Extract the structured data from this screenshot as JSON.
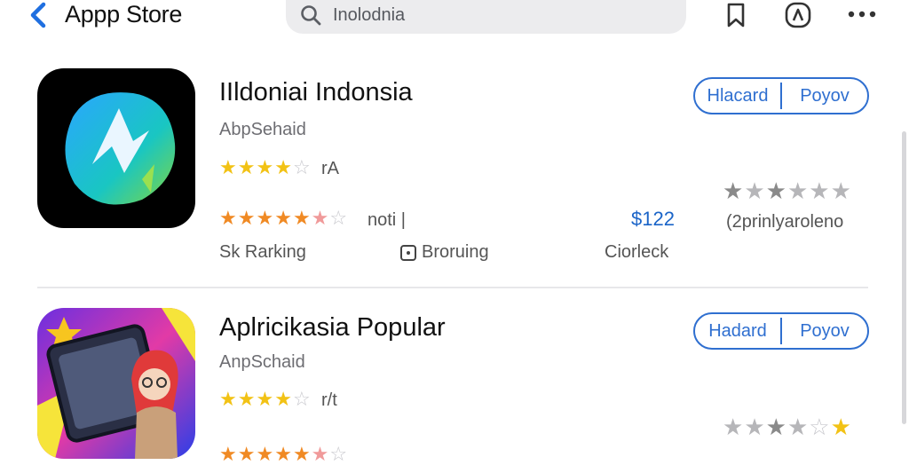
{
  "header": {
    "title": "Appp Store",
    "search_text": "Inolodnia"
  },
  "apps": [
    {
      "name": "IIldoniai Indonsia",
      "developer": "AbpSehaid",
      "rating_label": "rA",
      "rating2_label": "noti |",
      "price": "$122",
      "button_left": "Hlacard",
      "button_right": "Poyov",
      "side_text": "(2prinlyaroleno",
      "ranking": "Sk Rarking",
      "browsing": "Broruing",
      "storage": "Ciorleck"
    },
    {
      "name": "Aplricikasia Popular",
      "developer": "AnpSchaid",
      "rating_label": "r/t",
      "button_left": "Hadard",
      "button_right": "Poyov"
    }
  ],
  "colors": {
    "accent": "#2f6fd0",
    "star_gold": "#f2c215",
    "star_orange": "#f08a24",
    "price_blue": "#1a64c8"
  }
}
